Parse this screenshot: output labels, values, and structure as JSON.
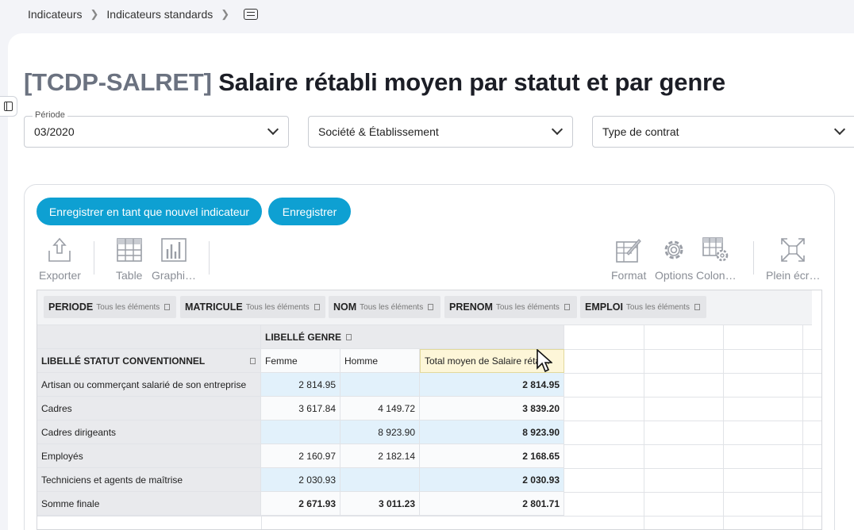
{
  "breadcrumb": {
    "items": [
      "Indicateurs",
      "Indicateurs standards"
    ]
  },
  "title": {
    "code": "[TCDP-SALRET]",
    "name": "Salaire rétabli moyen par statut et par genre"
  },
  "filters": {
    "periode": {
      "label": "Période",
      "value": "03/2020"
    },
    "societe": {
      "value": "Société & Établissement"
    },
    "contrat": {
      "value": "Type de contrat"
    }
  },
  "buttons": {
    "save_new": "Enregistrer en tant que nouvel indicateur",
    "save": "Enregistrer"
  },
  "toolbar": {
    "export": "Exporter",
    "table": "Table",
    "graph": "Graphi…",
    "format": "Format",
    "options": "Options",
    "columns": "Colon…",
    "fullscreen": "Plein écr…"
  },
  "fields": [
    {
      "name": "PERIODE",
      "sub": "Tous les éléments"
    },
    {
      "name": "MATRICULE",
      "sub": "Tous les éléments"
    },
    {
      "name": "NOM",
      "sub": "Tous les éléments"
    },
    {
      "name": "PRENOM",
      "sub": "Tous les éléments"
    },
    {
      "name": "EMPLOI",
      "sub": "Tous les éléments"
    }
  ],
  "pivot": {
    "column_field": "LIBELLÉ GENRE",
    "row_field": "LIBELLÉ STATUT CONVENTIONNEL",
    "columns": [
      "Femme",
      "Homme",
      "Total moyen de Salaire réta…"
    ],
    "rows": [
      {
        "label": "Artisan ou commerçant salarié de son entreprise",
        "femme": "2 814.95",
        "homme": "",
        "total": "2 814.95"
      },
      {
        "label": "Cadres",
        "femme": "3 617.84",
        "homme": "4 149.72",
        "total": "3 839.20"
      },
      {
        "label": "Cadres dirigeants",
        "femme": "",
        "homme": "8 923.90",
        "total": "8 923.90"
      },
      {
        "label": "Employés",
        "femme": "2 160.97",
        "homme": "2 182.14",
        "total": "2 168.65"
      },
      {
        "label": "Techniciens et agents de maîtrise",
        "femme": "2 030.93",
        "homme": "",
        "total": "2 030.93"
      },
      {
        "label": "Somme finale",
        "femme": "2 671.93",
        "homme": "3 011.23",
        "total": "2 801.71"
      }
    ]
  },
  "colors": {
    "accent": "#0ea0d2",
    "highlight": "#e2f1fb",
    "total_header": "#fdf6d8"
  }
}
